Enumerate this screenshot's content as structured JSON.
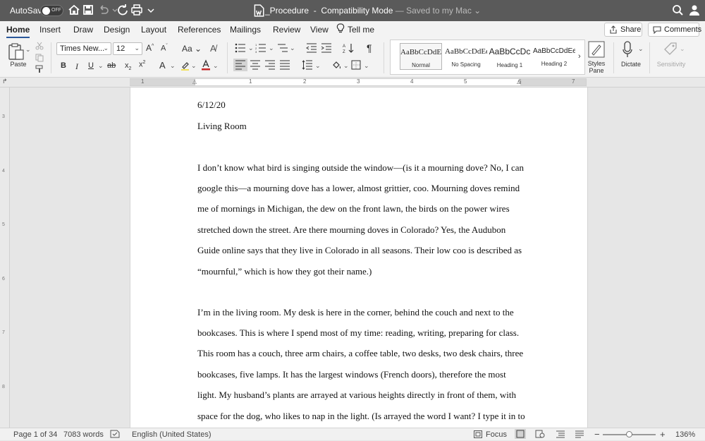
{
  "titlebar": {
    "autosave": "AutoSave",
    "toggle": "OFF",
    "doc_name": "_Procedure",
    "separator": " — ",
    "mode": "Compatibility Mode",
    "saved": "— Saved to my Mac ⌄"
  },
  "tabs": [
    "Home",
    "Insert",
    "Draw",
    "Design",
    "Layout",
    "References",
    "Mailings",
    "Review",
    "View",
    "Tell me"
  ],
  "tell_me_icon": "lightbulb-icon",
  "share": "Share",
  "comments": "Comments",
  "ribbon": {
    "paste": "Paste",
    "font_name": "Times New...",
    "font_size": "12",
    "styles": [
      {
        "preview": "AaBbCcDdEe",
        "name": "Normal"
      },
      {
        "preview": "AaBbCcDdEe",
        "name": "No Spacing"
      },
      {
        "preview": "AaBbCcDc",
        "name": "Heading 1"
      },
      {
        "preview": "AaBbCcDdEe",
        "name": "Heading 2"
      }
    ],
    "styles_pane": "Styles Pane",
    "dictate": "Dictate",
    "sensitivity": "Sensitivity"
  },
  "ruler_numbers": [
    "1",
    "1",
    "2",
    "3",
    "4",
    "5",
    "6",
    "7"
  ],
  "vruler_numbers": [
    "3",
    "4",
    "5",
    "6",
    "7",
    "8"
  ],
  "document": {
    "lines": [
      "6/12/20",
      "Living Room",
      "I don’t know what bird is singing outside the window—(is it a mourning dove? No, I can",
      "google this—a mourning dove has a lower, almost grittier, coo. Mourning doves remind",
      "me of mornings in Michigan, the dew on the front lawn, the birds on the power wires",
      "stretched down the street. Are there mourning doves in Colorado? Yes, the Audubon",
      "Guide online says that they live in Colorado in all seasons. Their low coo is described as",
      "“mournful,” which is how they got their name.)",
      "I’m in the living room. My desk is here in the corner, behind the couch and next to the",
      "bookcases. This is where I spend most of my time: reading, writing, preparing for class.",
      "This room has a couch, three arm chairs, a coffee table, two desks, two desk chairs, three",
      "bookcases, five lamps. It has the largest windows (French doors), therefore the most",
      "light. My husband’s plants are arrayed at various heights directly in front of them, with",
      "space for the dog, who likes to nap in the light. (Is arrayed the word I want? I type it in to"
    ]
  },
  "status": {
    "page": "Page 1 of 34",
    "words": "7083 words",
    "language": "English (United States)",
    "focus": "Focus",
    "zoom": "136%",
    "zoom_level": 0.5
  }
}
